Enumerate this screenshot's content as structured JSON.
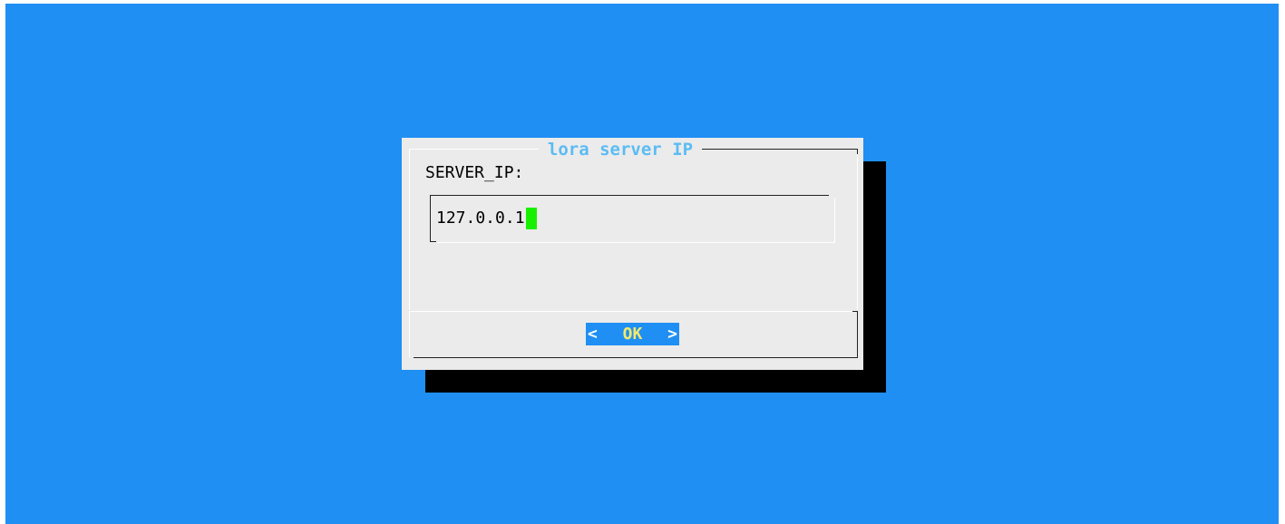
{
  "colors": {
    "background": "#1f8ff4",
    "dialog": "#ebebeb",
    "title": "#5bbcf3",
    "cursor": "#19f000",
    "button_active": "#1f8ff4",
    "button_label": "#f5e86a"
  },
  "dialog": {
    "title": "lora server IP",
    "prompt_label": "SERVER_IP:",
    "input_value": "127.0.0.1"
  },
  "buttons": {
    "ok": {
      "left_bracket": "<",
      "label": "OK",
      "right_bracket": ">"
    }
  }
}
